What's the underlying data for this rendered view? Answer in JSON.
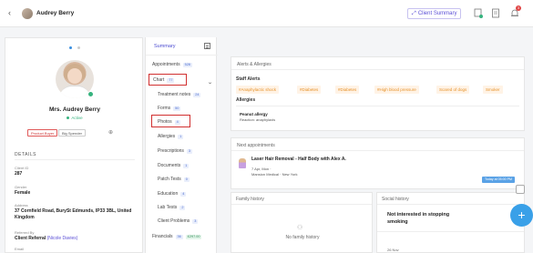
{
  "header": {
    "back_glyph": "‹",
    "client_name": "Audrey Berry",
    "summary_button": "Client Summary",
    "notification_count": "3"
  },
  "profile": {
    "name": "Mrs. Audrey Berry",
    "status": "Active",
    "tags": [
      "Product Buyer",
      "Big Spender"
    ],
    "add_glyph": "⊕",
    "details_title": "DETAILS",
    "fields": [
      {
        "label": "Client ID",
        "value": "287"
      },
      {
        "label": "Gender",
        "value": "Female"
      },
      {
        "label": "Address",
        "value": "37 Cornfield Road, BurySt Edmunds, IP33 3BL, United Kingdom"
      },
      {
        "label": "Referred By",
        "value_prefix": "Client Referral ",
        "value_link": "(Nicole Davies)"
      },
      {
        "label": "Email",
        "value": ""
      }
    ]
  },
  "nav": {
    "header_label": "Summary",
    "items": [
      {
        "label": "Appointments",
        "count": "528"
      },
      {
        "label": "Chart",
        "count": "77"
      },
      {
        "label": "Treatment notes",
        "count": "24"
      },
      {
        "label": "Forms",
        "count": "50"
      },
      {
        "label": "Photos",
        "count": "4"
      },
      {
        "label": "Allergies",
        "count": "1"
      },
      {
        "label": "Prescriptions",
        "count": "3"
      },
      {
        "label": "Documents",
        "count": "1"
      },
      {
        "label": "Patch Tests",
        "count": "0"
      },
      {
        "label": "Education",
        "count": "4"
      },
      {
        "label": "Lab Tests",
        "count": "2"
      },
      {
        "label": "Client Problems",
        "count": "3"
      },
      {
        "label": "Financials",
        "count": "36",
        "extra": "£297.00"
      }
    ]
  },
  "alerts": {
    "title": "Alerts & Allergies",
    "staff_alerts_label": "Staff Alerts",
    "chips": [
      "#Anaphylactic shock",
      "#Diabetes",
      "#Diabetes",
      "#High blood pressure",
      "Scared of dogs",
      "Smoker"
    ],
    "allergies_label": "Allergies",
    "allergy_name": "Peanut allergy",
    "allergy_reaction": "Reaction: anaphylaxis"
  },
  "appointments": {
    "title": "Next appointments",
    "service": "Laser Hair Removal - Half Body with Alex A.",
    "date": "7 Apr, Mon  ·",
    "location": "Mansion Medical · New York",
    "badge": "Today at 05:00 PM"
  },
  "family_history": {
    "title": "Family history",
    "empty": "No family history"
  },
  "social_history": {
    "title": "Social history",
    "entry": "Not interested in stopping smoking",
    "footer": "26 Nov"
  },
  "fab_label": "+",
  "colors": {
    "accent": "#5b4fd6",
    "highlight_box": "#d13030",
    "alert_chip_bg": "#fff3e6",
    "alert_chip_text": "#e6922a",
    "fab": "#39a0e8",
    "active_green": "#36b37e"
  }
}
